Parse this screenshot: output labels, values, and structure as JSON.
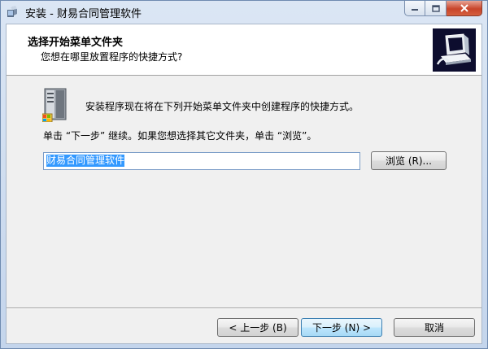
{
  "window": {
    "title": "安装 - 财易合同管理软件",
    "icons": {
      "app": "installer-icon",
      "minimize": "minimize-icon",
      "maximize": "maximize-icon",
      "close": "close-icon"
    }
  },
  "header": {
    "title": "选择开始菜单文件夹",
    "subtitle": "您想在哪里放置程序的快捷方式?"
  },
  "body": {
    "description": "安装程序现在将在下列开始菜单文件夹中创建程序的快捷方式。",
    "hint": "单击 “下一步” 继续。如果您想选择其它文件夹，单击 “浏览”。",
    "folder_value": "财易合同管理软件",
    "browse_label": "浏览 (R)..."
  },
  "footer": {
    "back_label": "< 上一步 (B)",
    "next_label": "下一步 (N) >",
    "cancel_label": "取消"
  },
  "colors": {
    "selection": "#3399ff",
    "client_bg": "#f0f0f0",
    "close_red": "#c8442a"
  }
}
